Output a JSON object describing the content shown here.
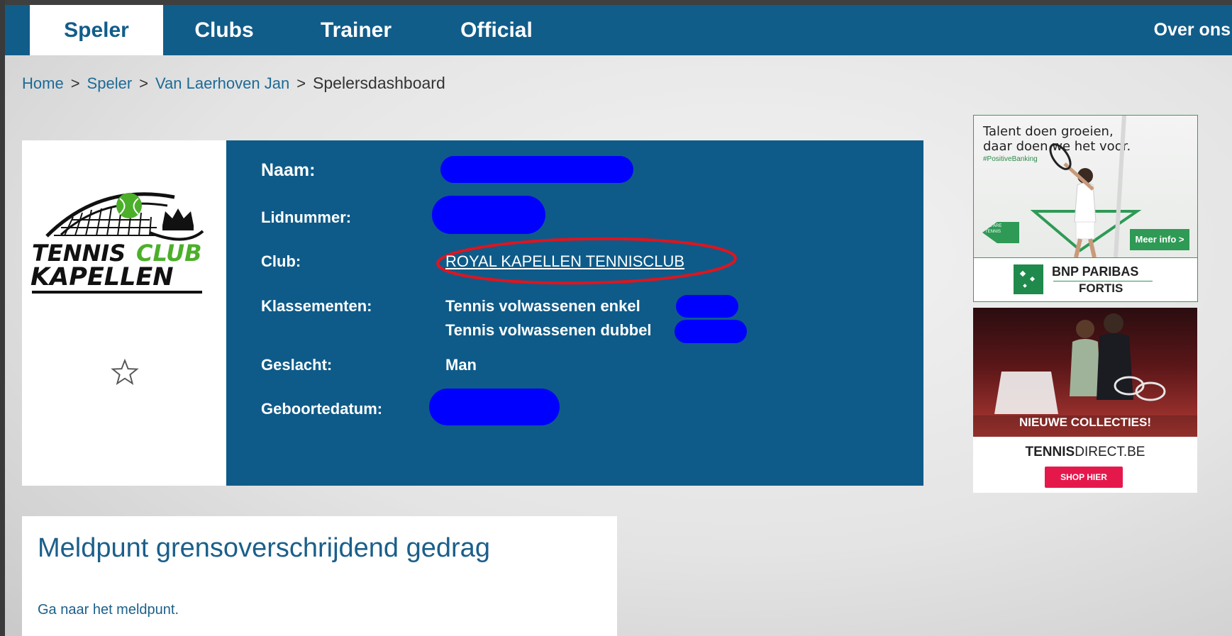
{
  "nav": {
    "items": [
      {
        "label": "Speler",
        "active": true
      },
      {
        "label": "Clubs",
        "active": false
      },
      {
        "label": "Trainer",
        "active": false
      },
      {
        "label": "Official",
        "active": false
      }
    ],
    "right_link": "Over ons"
  },
  "breadcrumb": {
    "items": [
      "Home",
      "Speler",
      "Van Laerhoven Jan"
    ],
    "separator": ">",
    "current": "Spelersdashboard"
  },
  "profile": {
    "logo": {
      "line1_a": "TENNIS",
      "line1_b": "CLUB",
      "line2": "KAPELLEN"
    },
    "favorite_icon": "star-outline-icon",
    "labels": {
      "naam": "Naam:",
      "lidnummer": "Lidnummer:",
      "club": "Club:",
      "klassementen": "Klassementen:",
      "geslacht": "Geslacht:",
      "geboortedatum": "Geboortedatum:"
    },
    "club_value": "ROYAL KAPELLEN TENNISCLUB",
    "klassementen": [
      "Tennis volwassenen enkel",
      "Tennis volwassenen dubbel"
    ],
    "geslacht_value": "Man"
  },
  "ads": {
    "bnp": {
      "headline_1": "Talent doen groeien,",
      "headline_2": "daar doen we het voor.",
      "hashtag": "#PositiveBanking",
      "badge": "WE ARE TENNIS",
      "button": "Meer info >",
      "brand_1": "BNP PARIBAS",
      "brand_2": "FORTIS"
    },
    "tennisdirect": {
      "banner": "NIEUWE COLLECTIES!",
      "brand_a": "TENNIS",
      "brand_b": "DIRECT.BE",
      "button": "SHOP HIER"
    }
  },
  "meldpunt": {
    "title": "Meldpunt grensoverschrijdend gedrag",
    "link": "Ga naar het meldpunt."
  },
  "colors": {
    "nav_bg": "#115d8a",
    "info_bg": "#0e5b89",
    "redaction": "#0000ff",
    "annotation_circle": "#e0141e"
  }
}
